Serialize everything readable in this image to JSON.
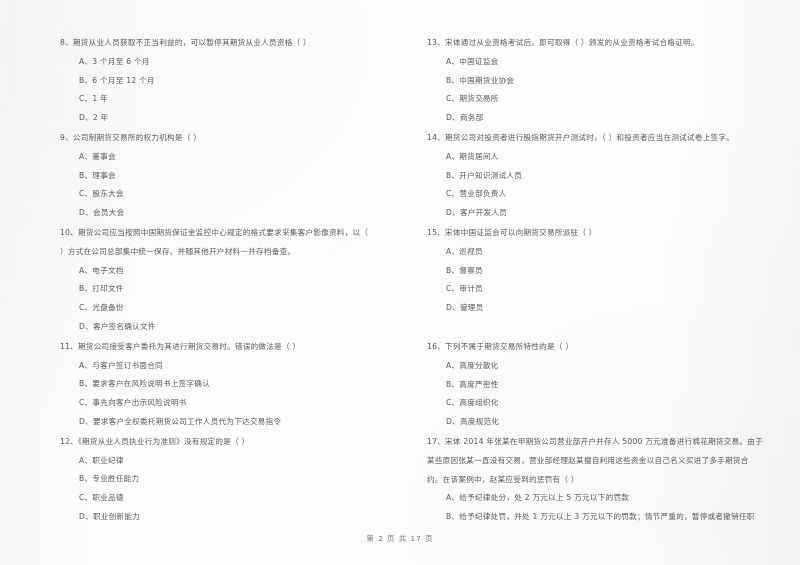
{
  "document": {
    "type": "exam-paper-scan",
    "footer": "第 2 页 共 17 页",
    "ink_color": "#4c4c51",
    "page_color": "#fbfbfa"
  },
  "left_column": [
    {
      "number": "8",
      "stem": "8、期货从业人员获取不正当利益的，可以暂停其期货从业人员资格（      ）",
      "stem_cont": "",
      "options": [
        "A、3 个月至 6 个月",
        "B、6 个月至 12 个月",
        "C、1 年",
        "D、2 年"
      ]
    },
    {
      "number": "9",
      "stem": "9、公司制期货交易所的权力机构是（      ）",
      "stem_cont": "",
      "options": [
        "A、董事会",
        "B、理事会",
        "C、股东大会",
        "D、会员大会"
      ]
    },
    {
      "number": "10",
      "stem": "10、期货公司应当按照中国期货保证金监控中心规定的格式要求采集客户影像资料，以（",
      "stem_cont": "）方式在公司总部集中统一保存。并随其他开户材料一并存档备查。",
      "options": [
        "A、电子文档",
        "B、打印文件",
        "C、光盘备份",
        "D、客户签名确认文件"
      ]
    },
    {
      "number": "11",
      "stem": "11、期货公司接受客户委托为其进行期货交易时。错误的做法是（      ）",
      "stem_cont": "",
      "options": [
        "A、与客户签订书面合同",
        "B、要求客户在风险说明书上签字确认",
        "C、事先向客户出示风险说明书",
        "D、要求客户全权委托期货公司工作人员代为下达交易指令"
      ]
    },
    {
      "number": "12",
      "stem": "12、《期货从业人员执业行为准则》没有规定的是（      ）",
      "stem_cont": "",
      "options": [
        "A、职业纪律",
        "B、专业胜任能力",
        "C、职业品德",
        "D、职业创新能力"
      ]
    }
  ],
  "right_column": [
    {
      "number": "13",
      "stem": "13、宋体通过从业资格考试后。即可取得（      ）颁发的从业资格考试合格证明。",
      "stem_cont": "",
      "options": [
        "A、中国证监会",
        "B、中国期货业协会",
        "C、期货交易所",
        "D、商务部"
      ]
    },
    {
      "number": "14",
      "stem": "14、期货公司对投资者进行股指期货开户测试时，（      ）和投资者应当在测试试卷上签字。",
      "stem_cont": "",
      "options": [
        "A、期货居间人",
        "B、开户知识测试人员",
        "C、营业部负责人",
        "D、客户开发人员"
      ]
    },
    {
      "number": "15",
      "stem": "15、宋体中国证监会可以向期货交易所派驻（      ）",
      "stem_cont": "",
      "options": [
        "A、巡视员",
        "B、督察员",
        "C、审计员",
        "D、管理员"
      ]
    },
    {
      "number": "16",
      "stem": "16、下列不属于期货交易所特性的是（      ）",
      "stem_cont": "",
      "options": [
        "A、高度分散化",
        "B、高度严密性",
        "C、高度组织化",
        "D、高度规范化"
      ]
    },
    {
      "number": "17",
      "stem": "17、宋体 2014 年张某在甲期货公司营业部开户并存人 5000 万元准备进行棉花期货交易。由于",
      "stem_cont": "某些原因张某一直没有交易，营业部经理赵某擅自利用这些资金以自己名义买进了多手期货合",
      "stem_cont2": "约。在该案例中，赵某应受到的惩罚有（      ）",
      "options": [
        "A、给予纪律处分，处 2 万元以上 5 万元以下的罚款",
        "B、给予纪律处罚，并处 1 万元以上 3 万元以下的罚款；情节严重的，暂停或者撤销任职"
      ]
    }
  ]
}
